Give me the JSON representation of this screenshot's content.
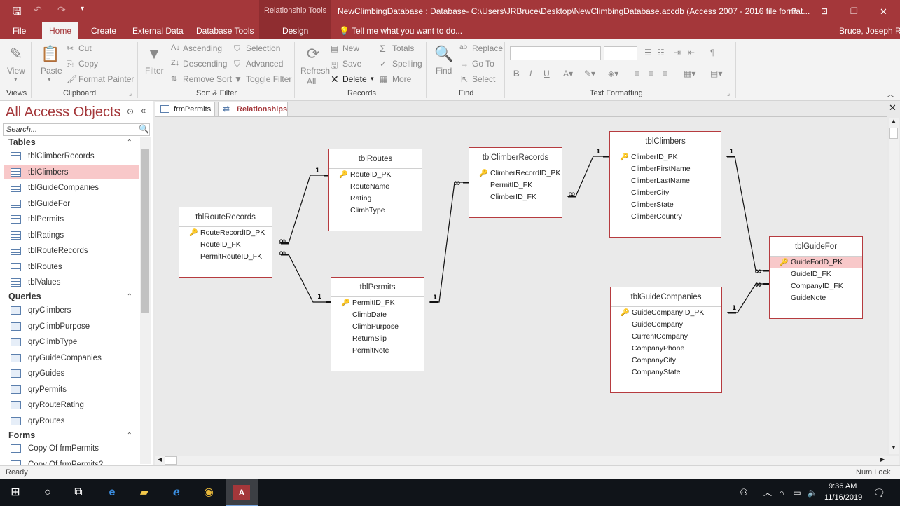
{
  "titlebar": {
    "context_group": "Relationship Tools",
    "title": "NewClimbingDatabase : Database- C:\\Users\\JRBruce\\Desktop\\NewClimbingDatabase.accdb (Access 2007 - 2016 file format...",
    "help": "?",
    "restore": "❐",
    "minimize": "—",
    "close": "✕"
  },
  "ribbon_tabs": {
    "file": "File",
    "home": "Home",
    "create": "Create",
    "external": "External Data",
    "dbtools": "Database Tools",
    "design": "Design",
    "tell_me": "Tell me what you want to do...",
    "user": "Bruce, Joseph R"
  },
  "ribbon": {
    "view": "View",
    "paste": "Paste",
    "cut": "Cut",
    "copy": "Copy",
    "format_painter": "Format Painter",
    "filter": "Filter",
    "ascending": "Ascending",
    "descending": "Descending",
    "remove_sort": "Remove Sort",
    "selection": "Selection",
    "advanced": "Advanced",
    "toggle_filter": "Toggle Filter",
    "refresh": "Refresh",
    "refresh_all": "All",
    "new": "New",
    "save": "Save",
    "delete": "Delete",
    "totals": "Totals",
    "spelling": "Spelling",
    "more": "More",
    "find": "Find",
    "replace": "Replace",
    "goto": "Go To",
    "select": "Select",
    "bold": "B",
    "italic": "I",
    "underline": "U",
    "groups": {
      "views": "Views",
      "clipboard": "Clipboard",
      "sort_filter": "Sort & Filter",
      "records": "Records",
      "find": "Find",
      "text_formatting": "Text Formatting"
    }
  },
  "nav": {
    "title": "All Access Objects",
    "search_placeholder": "Search...",
    "sections": {
      "tables": "Tables",
      "queries": "Queries",
      "forms": "Forms"
    },
    "tables": [
      "tblClimberRecords",
      "tblClimbers",
      "tblGuideCompanies",
      "tblGuideFor",
      "tblPermits",
      "tblRatings",
      "tblRouteRecords",
      "tblRoutes",
      "tblValues"
    ],
    "queries": [
      "qryClimbers",
      "qryClimbPurpose",
      "qryClimbType",
      "qryGuideCompanies",
      "qryGuides",
      "qryPermits",
      "qryRouteRating",
      "qryRoutes"
    ],
    "forms": [
      "Copy Of frmPermits",
      "Copy Of frmPermits2"
    ]
  },
  "doc_tabs": [
    "frmPermits",
    "Relationships"
  ],
  "relationships": {
    "tables": [
      {
        "title": "tblRouteRecords",
        "fields": [
          "RouteRecordID_PK",
          "RouteID_FK",
          "PermitRouteID_FK"
        ]
      },
      {
        "title": "tblRoutes",
        "fields": [
          "RouteID_PK",
          "RouteName",
          "Rating",
          "ClimbType"
        ]
      },
      {
        "title": "tblPermits",
        "fields": [
          "PermitID_PK",
          "ClimbDate",
          "ClimbPurpose",
          "ReturnSlip",
          "PermitNote"
        ]
      },
      {
        "title": "tblClimberRecords",
        "fields": [
          "ClimberRecordID_PK",
          "PermitID_FK",
          "ClimberID_FK"
        ]
      },
      {
        "title": "tblClimbers",
        "fields": [
          "ClimberID_PK",
          "ClimberFirstName",
          "ClimberLastName",
          "ClimberCity",
          "ClimberState",
          "ClimberCountry"
        ]
      },
      {
        "title": "tblGuideCompanies",
        "fields": [
          "GuideCompanyID_PK",
          "GuideCompany",
          "CurrentCompany",
          "CompanyPhone",
          "CompanyCity",
          "CompanyState"
        ]
      },
      {
        "title": "tblGuideFor",
        "fields": [
          "GuideForID_PK",
          "GuideID_FK",
          "CompanyID_FK",
          "GuideNote"
        ]
      }
    ],
    "one_label": "1",
    "many_label": "∞"
  },
  "status": {
    "left": "Ready",
    "right": "Num Lock"
  },
  "taskbar": {
    "time": "9:36 AM",
    "date": "11/16/2019"
  },
  "colors": {
    "accent": "#a4373a",
    "selected": "#f8c8c9"
  }
}
